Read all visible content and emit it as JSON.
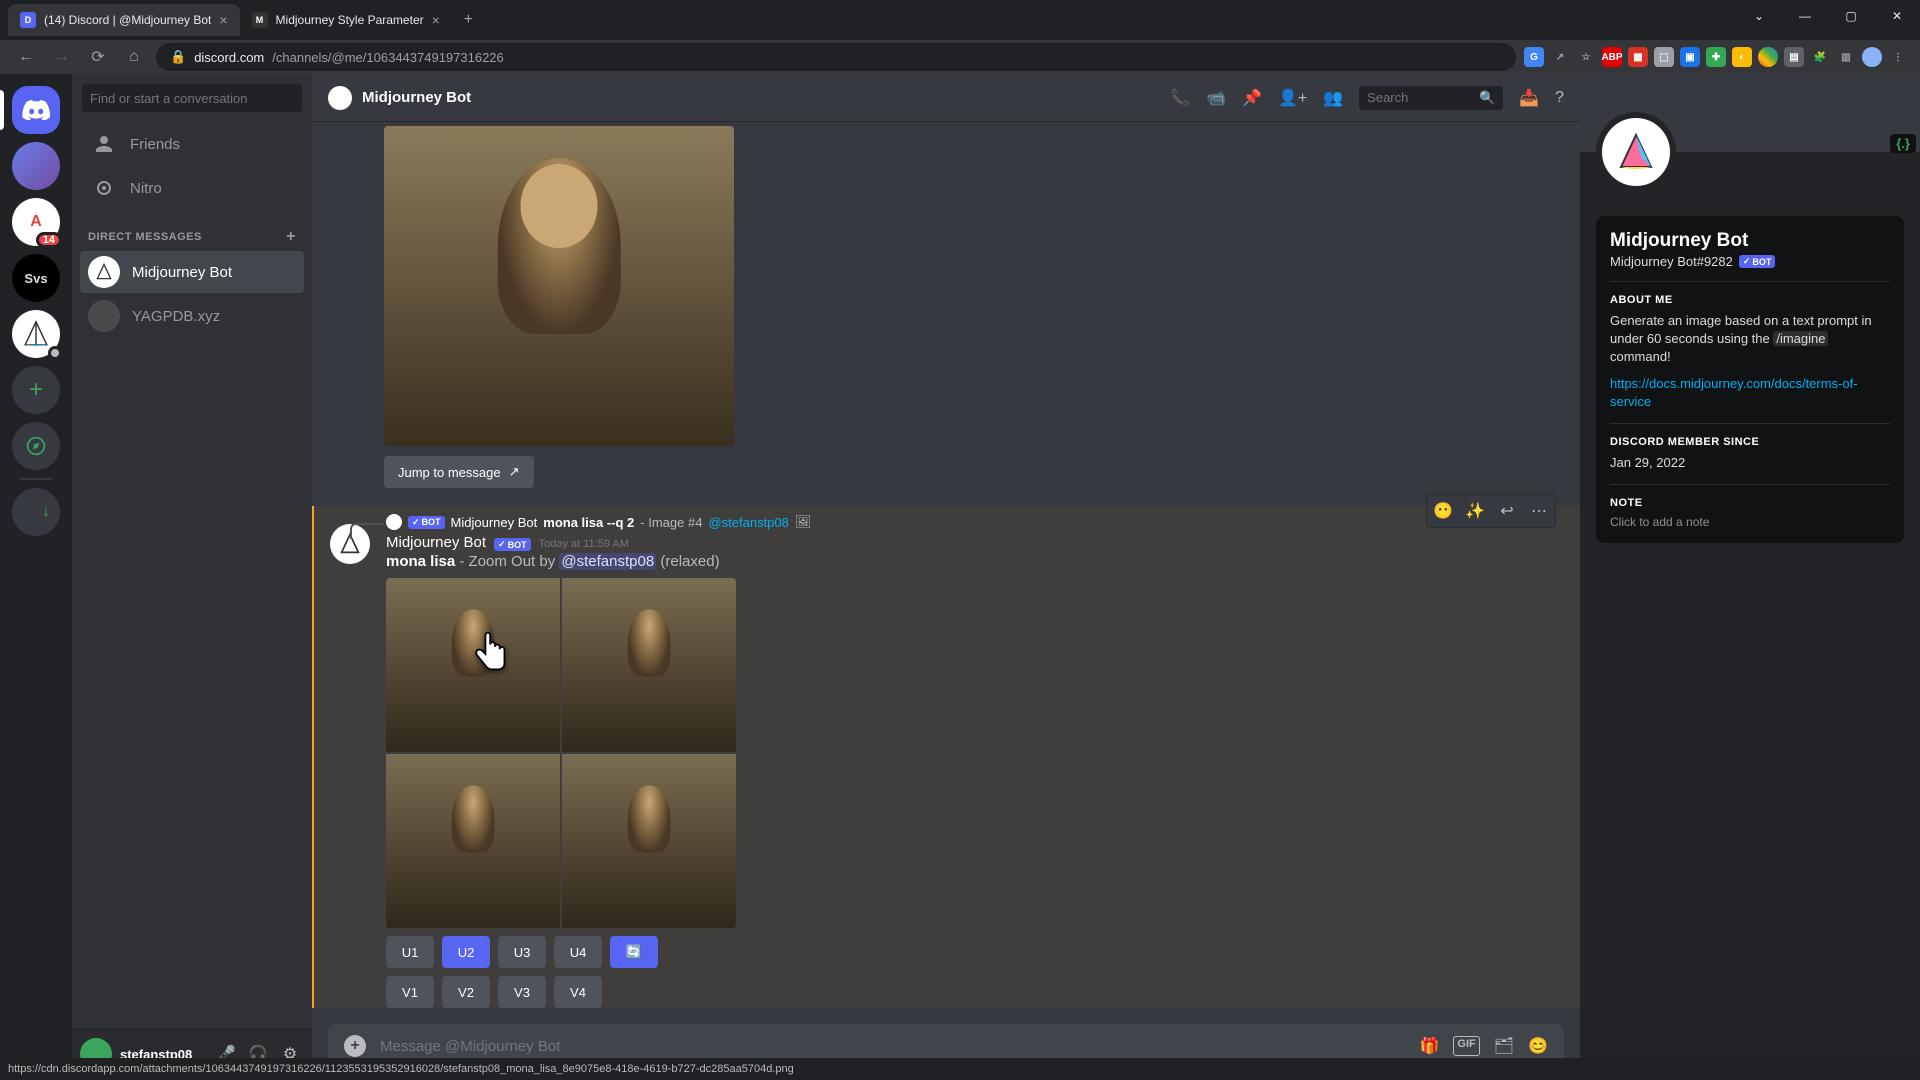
{
  "browser": {
    "tabs": [
      {
        "title": "(14) Discord | @Midjourney Bot",
        "favicon": "D"
      },
      {
        "title": "Midjourney Style Parameter",
        "favicon": "M"
      }
    ],
    "url_host": "discord.com",
    "url_path": "/channels/@me/1063443749197316226"
  },
  "sidebar": {
    "search_placeholder": "Find or start a conversation",
    "friends": "Friends",
    "nitro": "Nitro",
    "dm_header": "DIRECT MESSAGES",
    "dms": [
      {
        "name": "Midjourney Bot"
      },
      {
        "name": "YAGPDB.xyz"
      }
    ]
  },
  "server_rail": {
    "svs_label": "Svs",
    "badge_count": "14"
  },
  "user_panel": {
    "username": "stefanstp08"
  },
  "chat": {
    "header_title": "Midjourney Bot",
    "search_placeholder": "Search",
    "jump_label": "Jump to message",
    "reply_ref": {
      "bot_name": "Midjourney Bot",
      "bot_tag": "BOT",
      "prompt": "mona lisa --q 2",
      "suffix": "- Image #4",
      "mention": "@stefanstp08"
    },
    "message": {
      "author": "Midjourney Bot",
      "bot_tag": "BOT",
      "timestamp": "Today at 11:59 AM",
      "bold_part": "mona lisa",
      "mid_part": " - Zoom Out by ",
      "mention": "@stefanstp08",
      "trail": " (relaxed)"
    },
    "buttons_u": [
      "U1",
      "U2",
      "U3",
      "U4"
    ],
    "buttons_v": [
      "V1",
      "V2",
      "V3",
      "V4"
    ],
    "input_placeholder": "Message @Midjourney Bot",
    "gif_label": "GIF"
  },
  "profile": {
    "name": "Midjourney Bot",
    "tag": "Midjourney Bot#9282",
    "bot_tag": "BOT",
    "about_header": "ABOUT ME",
    "about_text_1": "Generate an image based on a text prompt in under 60 seconds using the ",
    "about_cmd": "/imagine",
    "about_text_2": " command!",
    "about_link": "https://docs.midjourney.com/docs/terms-of-service",
    "member_header": "DISCORD MEMBER SINCE",
    "member_date": "Jan 29, 2022",
    "note_header": "NOTE",
    "note_placeholder": "Click to add a note",
    "code_btn": "{.}"
  },
  "status_url": "https://cdn.discordapp.com/attachments/1063443749197316226/1123553195352916028/stefanstp08_mona_lisa_8e9075e8-418e-4619-b727-dc285aa5704d.png"
}
